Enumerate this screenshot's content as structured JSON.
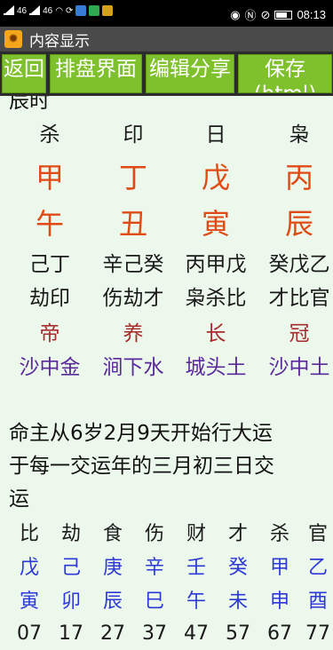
{
  "status": {
    "time": "08:13",
    "net1": "46",
    "net2": "46"
  },
  "title": "内容显示",
  "toolbar": {
    "buttons": [
      "返回",
      "排盘界面",
      "编辑分享",
      "保存(html)"
    ]
  },
  "content": {
    "top_cut_text": "辰时",
    "pillars": {
      "stars": [
        "杀",
        "印",
        "日",
        "枭"
      ],
      "stems": [
        "甲",
        "丁",
        "戊",
        "丙"
      ],
      "branches": [
        "午",
        "丑",
        "寅",
        "辰"
      ],
      "hidden": [
        "己丁",
        "辛己癸",
        "丙甲戊",
        "癸戊乙"
      ],
      "hidden_stars": [
        "劫印",
        "伤劫才",
        "枭杀比",
        "才比官"
      ],
      "stages": [
        "帝",
        "养",
        "长",
        "冠"
      ],
      "nayin": [
        "沙中金",
        "涧下水",
        "城头土",
        "沙中土"
      ]
    },
    "start_text": [
      "命主从6岁2月9天开始行大运",
      "于每一交运年的三月初三日交",
      "运"
    ],
    "dayun": {
      "stars": [
        "比",
        "劫",
        "食",
        "伤",
        "财",
        "才",
        "杀",
        "官"
      ],
      "stems": [
        "戊",
        "己",
        "庚",
        "辛",
        "壬",
        "癸",
        "甲",
        "乙"
      ],
      "branches": [
        "寅",
        "卯",
        "辰",
        "巳",
        "午",
        "未",
        "申",
        "酉"
      ],
      "ages": [
        "07",
        "17",
        "27",
        "37",
        "47",
        "57",
        "67",
        "77"
      ]
    }
  },
  "colors": {
    "toolbar_btn": "#7fc12c",
    "title_bg": "#4a4a4a",
    "content_bg": "#ecf8ec",
    "stem_red": "#e04a14",
    "dayun_blue": "#2c39d6",
    "nayin_purple": "#5a2a9a",
    "stage_maroon": "#a82c2c"
  }
}
